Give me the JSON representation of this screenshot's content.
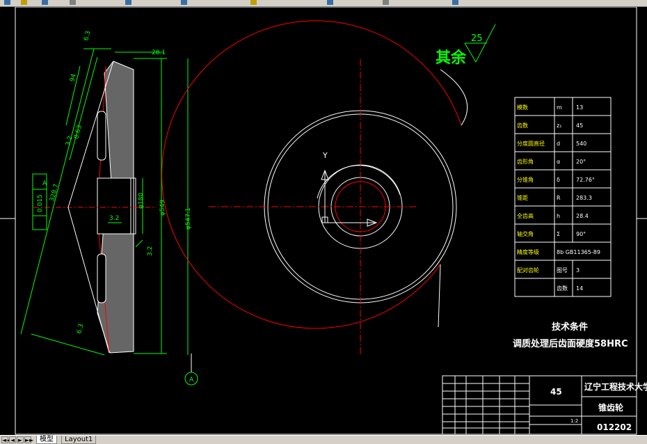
{
  "layout_tabs": [
    {
      "label": "模型",
      "active": true
    },
    {
      "label": "Layout1",
      "active": false
    }
  ],
  "nav_buttons": [
    "◄◄",
    "◄",
    "►",
    "►►"
  ],
  "drawing": {
    "roughness_other_label": "其余",
    "roughness_other_value": "25",
    "dims": {
      "d63": "6.3",
      "d281": "28.1",
      "d94": "94",
      "d32_top": "3.2",
      "d863": "8.63",
      "d3287": "328.7",
      "datum_A": "A",
      "tol": "0.015",
      "d180": "φ180",
      "d549": "φ549",
      "d547": "φ547.1",
      "d32_mid": "3.2",
      "d32_right": "3.2",
      "d63_bot": "6.3",
      "axis_y": "Y"
    },
    "params_table": [
      [
        "模数",
        "m",
        "13"
      ],
      [
        "齿数",
        "z₁",
        "45"
      ],
      [
        "分度圆直径",
        "d",
        "540"
      ],
      [
        "齿形角",
        "α",
        "20°"
      ],
      [
        "分锥角",
        "δ",
        "72.76°"
      ],
      [
        "锥距",
        "R",
        "283.3"
      ],
      [
        "全齿高",
        "h",
        "28.4"
      ],
      [
        "轴交角",
        "Σ",
        "90°"
      ],
      [
        "精度等级",
        "8b GB11365-89",
        ""
      ],
      [
        "配对齿轮",
        "图号",
        "3"
      ],
      [
        "",
        "齿数",
        "14"
      ]
    ],
    "tech_title": "技术条件",
    "tech_text": "调质处理后齿面硬度58HRC",
    "title_block": {
      "material": "45",
      "university": "辽宁工程技术大学",
      "part_name": "锥齿轮",
      "drawing_no": "012202",
      "scale": "1:2"
    }
  },
  "colors": {
    "background": "#000000",
    "line_white": "#ffffff",
    "dim_green": "#00ff00",
    "center_red": "#ff0000",
    "title_yellow": "#ffff00"
  }
}
